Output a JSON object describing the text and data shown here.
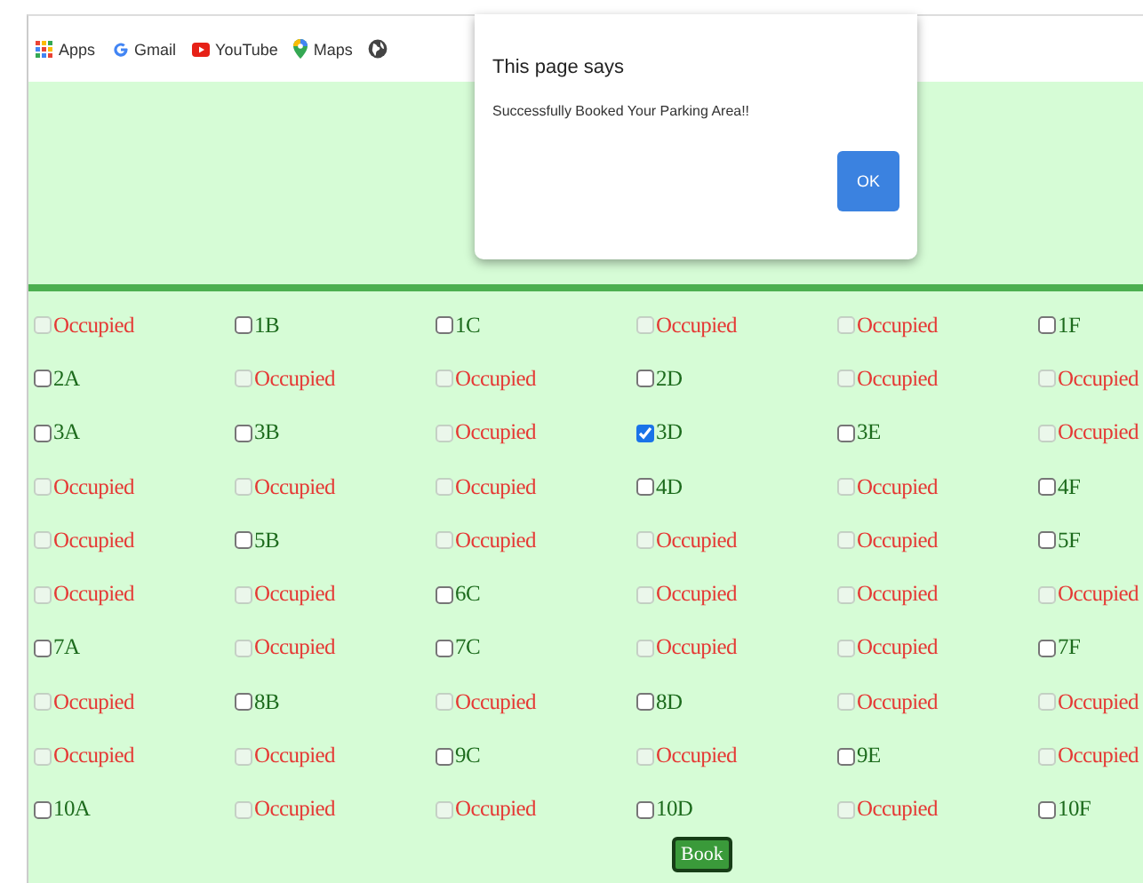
{
  "bookmarks": [
    {
      "kind": "apps",
      "label": "Apps"
    },
    {
      "kind": "google",
      "label": "Gmail"
    },
    {
      "kind": "youtube",
      "label": "YouTube"
    },
    {
      "kind": "maps",
      "label": "Maps"
    },
    {
      "kind": "globe"
    }
  ],
  "dialog": {
    "title": "This page says",
    "message": "Successfully Booked Your Parking Area!!",
    "button": "OK"
  },
  "slots": [
    [
      {
        "label": "Occupied",
        "disabled": true,
        "checked": false
      },
      {
        "label": "1B",
        "disabled": false,
        "checked": false
      },
      {
        "label": "1C",
        "disabled": false,
        "checked": false
      },
      {
        "label": "Occupied",
        "disabled": true,
        "checked": false
      },
      {
        "label": "Occupied",
        "disabled": true,
        "checked": false
      },
      {
        "label": "1F",
        "disabled": false,
        "checked": false
      }
    ],
    [
      {
        "label": "2A",
        "disabled": false,
        "checked": false
      },
      {
        "label": "Occupied",
        "disabled": true,
        "checked": false
      },
      {
        "label": "Occupied",
        "disabled": true,
        "checked": false
      },
      {
        "label": "2D",
        "disabled": false,
        "checked": false
      },
      {
        "label": "Occupied",
        "disabled": true,
        "checked": false
      },
      {
        "label": "Occupied",
        "disabled": true,
        "checked": false
      }
    ],
    [
      {
        "label": "3A",
        "disabled": false,
        "checked": false
      },
      {
        "label": "3B",
        "disabled": false,
        "checked": false
      },
      {
        "label": "Occupied",
        "disabled": true,
        "checked": false
      },
      {
        "label": "3D",
        "disabled": false,
        "checked": true
      },
      {
        "label": "3E",
        "disabled": false,
        "checked": false
      },
      {
        "label": "Occupied",
        "disabled": true,
        "checked": false
      }
    ],
    [
      {
        "label": "Occupied",
        "disabled": true,
        "checked": false
      },
      {
        "label": "Occupied",
        "disabled": true,
        "checked": false
      },
      {
        "label": "Occupied",
        "disabled": true,
        "checked": false
      },
      {
        "label": "4D",
        "disabled": false,
        "checked": false
      },
      {
        "label": "Occupied",
        "disabled": true,
        "checked": false
      },
      {
        "label": "4F",
        "disabled": false,
        "checked": false
      }
    ],
    [
      {
        "label": "Occupied",
        "disabled": true,
        "checked": false
      },
      {
        "label": "5B",
        "disabled": false,
        "checked": false
      },
      {
        "label": "Occupied",
        "disabled": true,
        "checked": false
      },
      {
        "label": "Occupied",
        "disabled": true,
        "checked": false
      },
      {
        "label": "Occupied",
        "disabled": true,
        "checked": false
      },
      {
        "label": "5F",
        "disabled": false,
        "checked": false
      }
    ],
    [
      {
        "label": "Occupied",
        "disabled": true,
        "checked": false
      },
      {
        "label": "Occupied",
        "disabled": true,
        "checked": false
      },
      {
        "label": "6C",
        "disabled": false,
        "checked": false
      },
      {
        "label": "Occupied",
        "disabled": true,
        "checked": false
      },
      {
        "label": "Occupied",
        "disabled": true,
        "checked": false
      },
      {
        "label": "Occupied",
        "disabled": true,
        "checked": false
      }
    ],
    [
      {
        "label": "7A",
        "disabled": false,
        "checked": false
      },
      {
        "label": "Occupied",
        "disabled": true,
        "checked": false
      },
      {
        "label": "7C",
        "disabled": false,
        "checked": false
      },
      {
        "label": "Occupied",
        "disabled": true,
        "checked": false
      },
      {
        "label": "Occupied",
        "disabled": true,
        "checked": false
      },
      {
        "label": "7F",
        "disabled": false,
        "checked": false
      }
    ],
    [
      {
        "label": "Occupied",
        "disabled": true,
        "checked": false
      },
      {
        "label": "8B",
        "disabled": false,
        "checked": false
      },
      {
        "label": "Occupied",
        "disabled": true,
        "checked": false
      },
      {
        "label": "8D",
        "disabled": false,
        "checked": false
      },
      {
        "label": "Occupied",
        "disabled": true,
        "checked": false
      },
      {
        "label": "Occupied",
        "disabled": true,
        "checked": false
      }
    ],
    [
      {
        "label": "Occupied",
        "disabled": true,
        "checked": false
      },
      {
        "label": "Occupied",
        "disabled": true,
        "checked": false
      },
      {
        "label": "9C",
        "disabled": false,
        "checked": false
      },
      {
        "label": "Occupied",
        "disabled": true,
        "checked": false
      },
      {
        "label": "9E",
        "disabled": false,
        "checked": false
      },
      {
        "label": "Occupied",
        "disabled": true,
        "checked": false
      }
    ],
    [
      {
        "label": "10A",
        "disabled": false,
        "checked": false
      },
      {
        "label": "Occupied",
        "disabled": true,
        "checked": false
      },
      {
        "label": "Occupied",
        "disabled": true,
        "checked": false
      },
      {
        "label": "10D",
        "disabled": false,
        "checked": false
      },
      {
        "label": "Occupied",
        "disabled": true,
        "checked": false
      },
      {
        "label": "10F",
        "disabled": false,
        "checked": false
      }
    ]
  ],
  "book_button": "Book"
}
